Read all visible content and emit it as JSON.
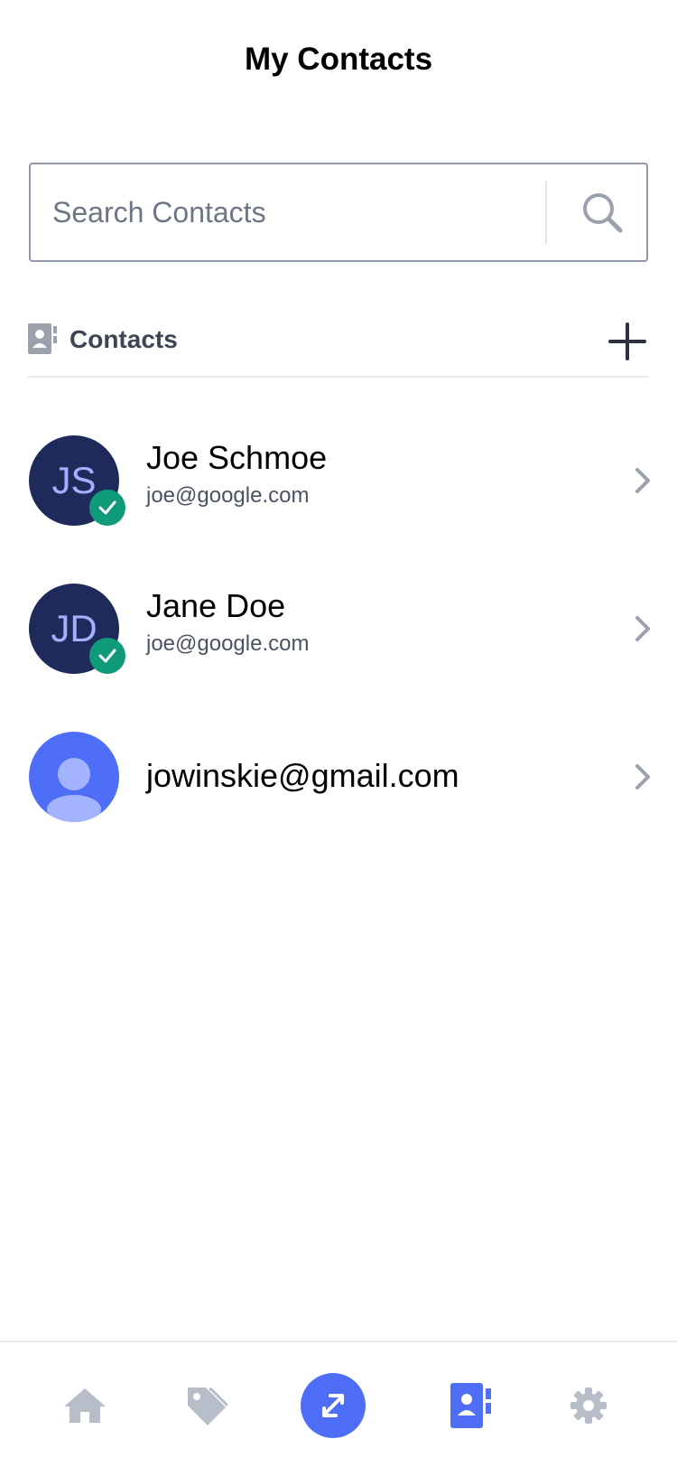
{
  "header": {
    "title": "My Contacts"
  },
  "search": {
    "placeholder": "Search Contacts",
    "value": ""
  },
  "section": {
    "title": "Contacts"
  },
  "contacts": [
    {
      "initials": "JS",
      "name": "Joe Schmoe",
      "email": "joe@google.com",
      "verified": true
    },
    {
      "initials": "JD",
      "name": "Jane Doe",
      "email": "joe@google.com",
      "verified": true
    },
    {
      "name": "jowinskie@gmail.com",
      "avatar": "person-placeholder",
      "verified": false
    }
  ],
  "tabs": [
    {
      "name": "home",
      "icon": "home-icon",
      "active": false
    },
    {
      "name": "tags",
      "icon": "tag-icon",
      "active": false
    },
    {
      "name": "transfer",
      "icon": "transfer-icon",
      "active": false,
      "featured": true
    },
    {
      "name": "contacts",
      "icon": "contact-book-icon",
      "active": true
    },
    {
      "name": "settings",
      "icon": "gear-icon",
      "active": false
    }
  ],
  "colors": {
    "accent": "#4f6ef7",
    "avatar_bg": "#1e2a5a",
    "avatar_text": "#a4b0ff",
    "verified": "#0f9a7a",
    "inactive_icon": "#b7bdc9"
  }
}
